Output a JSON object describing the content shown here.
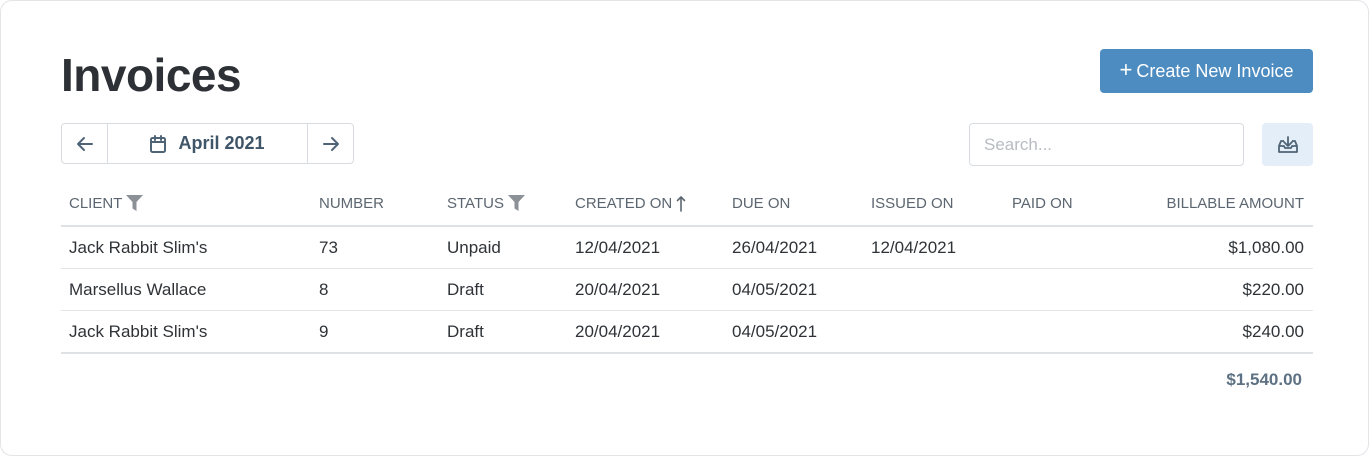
{
  "page": {
    "title": "Invoices"
  },
  "toolbar": {
    "create_button": {
      "icon": "+",
      "label": "Create New Invoice"
    },
    "month_nav": {
      "prev_icon": "arrow-left-icon",
      "next_icon": "arrow-right-icon",
      "calendar_icon": "calendar-icon",
      "label": "April 2021"
    },
    "search": {
      "placeholder": "Search...",
      "value": ""
    },
    "export_icon": "download-tray-icon"
  },
  "table": {
    "columns": [
      "Client",
      "Number",
      "Status",
      "Created On",
      "Due On",
      "Issued On",
      "Paid On",
      "Billable Amount"
    ],
    "rows": [
      {
        "client": "Jack Rabbit Slim's",
        "number": "73",
        "status": "Unpaid",
        "created_on": "12/04/2021",
        "due_on": "26/04/2021",
        "issued_on": "12/04/2021",
        "paid_on": "",
        "amount": "$1,080.00"
      },
      {
        "client": "Marsellus Wallace",
        "number": "8",
        "status": "Draft",
        "created_on": "20/04/2021",
        "due_on": "04/05/2021",
        "issued_on": "",
        "paid_on": "",
        "amount": "$220.00"
      },
      {
        "client": "Jack Rabbit Slim's",
        "number": "9",
        "status": "Draft",
        "created_on": "20/04/2021",
        "due_on": "04/05/2021",
        "issued_on": "",
        "paid_on": "",
        "amount": "$240.00"
      }
    ],
    "total": "$1,540.00"
  },
  "colors": {
    "primary_button": "#4d8cc0",
    "export_button_bg": "#e3eef8",
    "nav_text": "#3f5568",
    "total_text": "#5d7182"
  }
}
